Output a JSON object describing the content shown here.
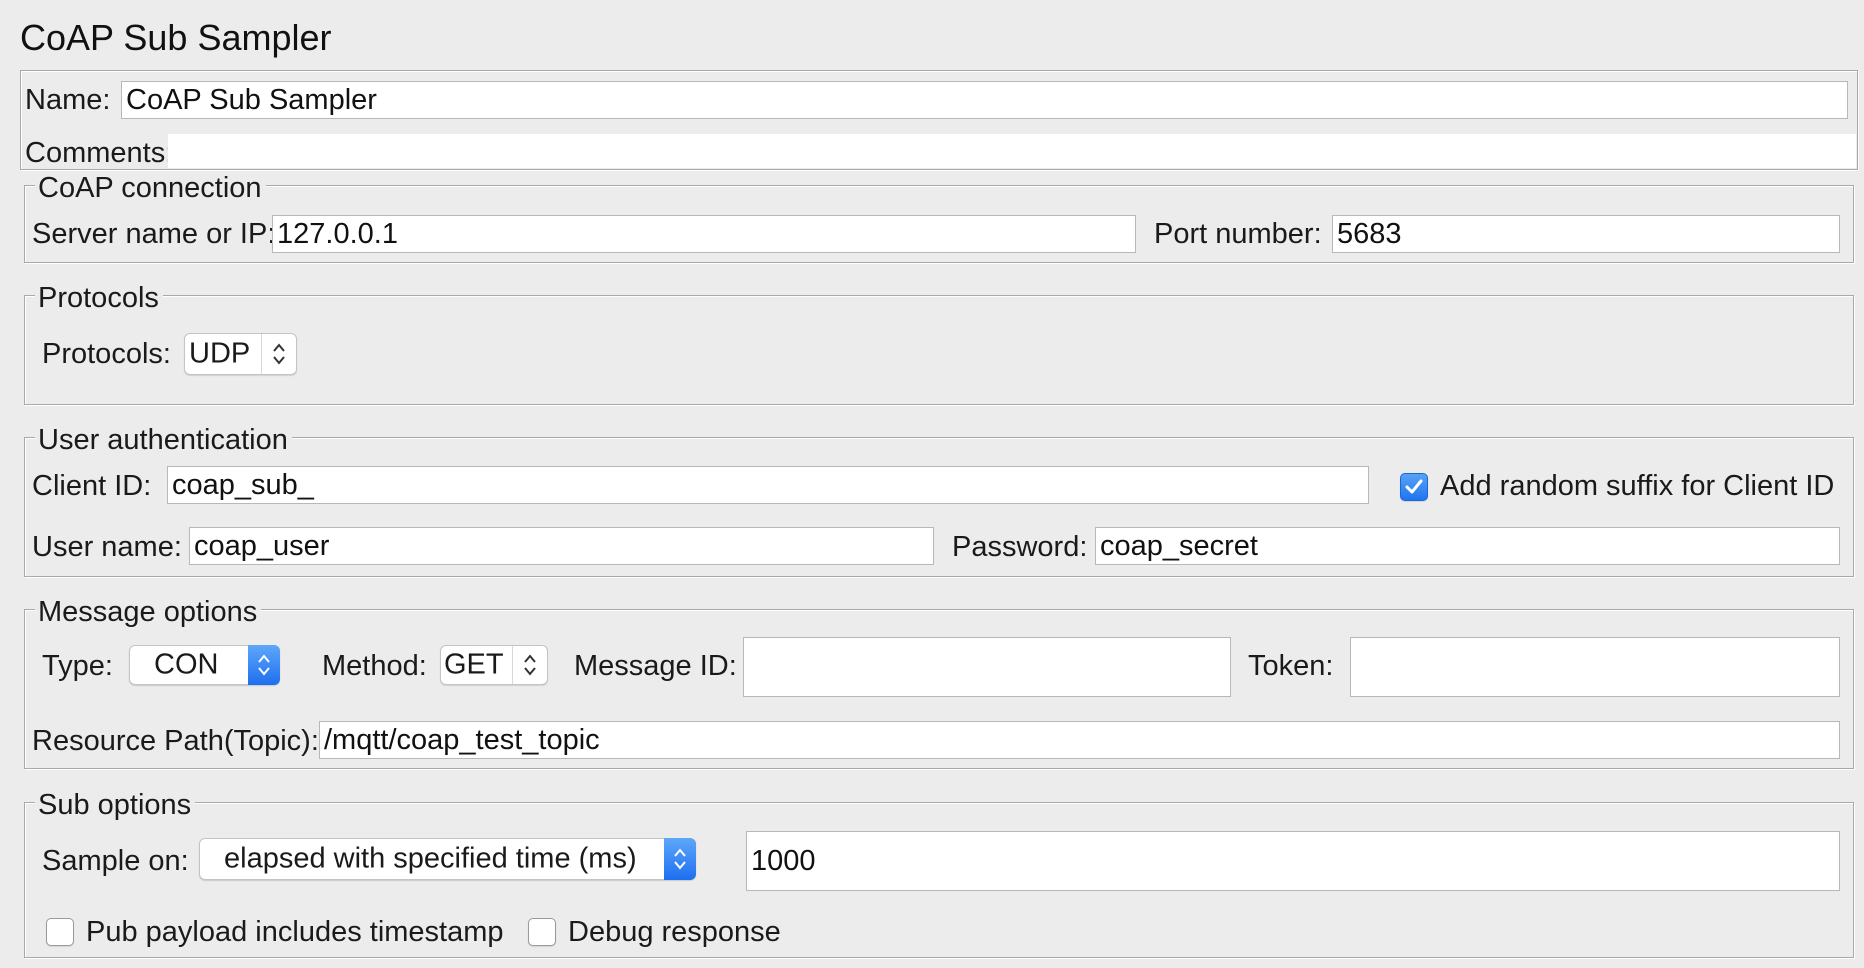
{
  "window": {
    "title": "CoAP Sub Sampler"
  },
  "name": {
    "label": "Name:",
    "value": "CoAP Sub Sampler"
  },
  "comments": {
    "label": "Comments:",
    "value": ""
  },
  "connection": {
    "legend": "CoAP connection",
    "server_label": "Server name or IP:",
    "server_value": "127.0.0.1",
    "port_label": "Port number:",
    "port_value": "5683"
  },
  "protocols": {
    "legend": "Protocols",
    "label": "Protocols:",
    "value": "UDP"
  },
  "auth": {
    "legend": "User authentication",
    "client_id_label": "Client ID:",
    "client_id_value": "coap_sub_",
    "random_suffix_label": "Add random suffix for Client ID",
    "random_suffix_checked": true,
    "username_label": "User name:",
    "username_value": "coap_user",
    "password_label": "Password:",
    "password_value": "coap_secret"
  },
  "message": {
    "legend": "Message options",
    "type_label": "Type:",
    "type_value": "CON",
    "method_label": "Method:",
    "method_value": "GET",
    "message_id_label": "Message ID:",
    "message_id_value": "",
    "token_label": "Token:",
    "token_value": "",
    "resource_label": "Resource Path(Topic):",
    "resource_value": "/mqtt/coap_test_topic"
  },
  "sub": {
    "legend": "Sub options",
    "sample_on_label": "Sample on:",
    "sample_on_value": "elapsed with specified time (ms)",
    "sample_time_value": "1000",
    "timestamp_label": "Pub payload includes timestamp",
    "timestamp_checked": false,
    "debug_label": "Debug response",
    "debug_checked": false
  },
  "colors": {
    "accent": "#1e6ff0",
    "background": "#ececec"
  }
}
